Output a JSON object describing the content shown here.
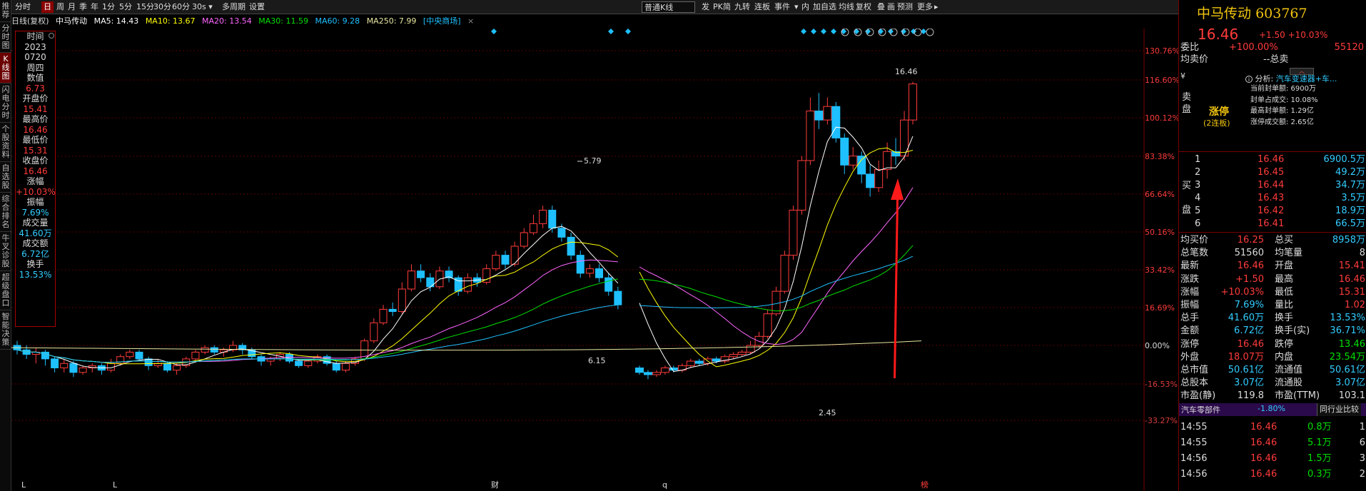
{
  "left_nav": [
    {
      "label": "推荐",
      "active": false
    },
    {
      "label": "分时图",
      "active": false
    },
    {
      "label": "K线图",
      "active": true
    },
    {
      "label": "闪电分时",
      "active": false
    },
    {
      "label": "个股资料",
      "active": false
    },
    {
      "label": "自选股",
      "active": false
    },
    {
      "label": "综合排名",
      "active": false
    },
    {
      "label": "牛叉诊股",
      "active": false
    },
    {
      "label": "超级盘口",
      "active": false
    },
    {
      "label": "智能决策",
      "active": false
    }
  ],
  "toolbar": {
    "items": [
      {
        "label": "分时",
        "active": false
      },
      {
        "label": "日",
        "active": true
      },
      {
        "label": "周",
        "active": false
      },
      {
        "label": "月",
        "active": false
      },
      {
        "label": "季",
        "active": false
      },
      {
        "label": "年",
        "active": false
      },
      {
        "label": "1分",
        "active": false
      },
      {
        "label": "5分",
        "active": false
      },
      {
        "label": "15分",
        "active": false
      },
      {
        "label": "30分",
        "active": false
      },
      {
        "label": "60分",
        "active": false
      },
      {
        "label": "30s ▾",
        "active": false
      },
      {
        "label": "多周期",
        "active": false
      },
      {
        "label": "设置",
        "active": false
      }
    ],
    "kline_type": "普通K线",
    "right_items": [
      "发",
      "PK",
      "简",
      "九转",
      "连板",
      "事件",
      "▾",
      "内",
      "加自选",
      "均线",
      "复权",
      "叠",
      "画",
      "预测",
      "更多",
      "▸"
    ]
  },
  "ma_bar": {
    "period": "日线(复权)",
    "stock": "中马传动",
    "ma5": "MA5: 14.43",
    "ma10": "MA10: 13.67",
    "ma20": "MA20: 13.54",
    "ma30": "MA30: 11.59",
    "ma60": "MA60: 9.28",
    "ma250": "MA250: 7.99",
    "tag": "[中央商场]",
    "close": "×"
  },
  "info_box": {
    "items": [
      {
        "label": "时间",
        "value": "2023",
        "cls": "wh"
      },
      {
        "label": "",
        "value": "0720",
        "cls": "wh"
      },
      {
        "label": "周四",
        "value": "",
        "cls": ""
      },
      {
        "label": "数值",
        "value": "6.73",
        "cls": ""
      },
      {
        "label": "开盘价",
        "value": "15.41",
        "cls": ""
      },
      {
        "label": "最高价",
        "value": "16.46",
        "cls": ""
      },
      {
        "label": "最低价",
        "value": "15.31",
        "cls": ""
      },
      {
        "label": "收盘价",
        "value": "16.46",
        "cls": ""
      },
      {
        "label": "涨幅",
        "value": "+10.03%",
        "cls": ""
      },
      {
        "label": "振幅",
        "value": "7.69%",
        "cls": "c"
      },
      {
        "label": "成交量",
        "value": "41.60万",
        "cls": "c"
      },
      {
        "label": "成交额",
        "value": "6.72亿",
        "cls": "c"
      },
      {
        "label": "换手",
        "value": "13.53%",
        "cls": "c"
      }
    ]
  },
  "y_axis": [
    "130.76%",
    "116.60%",
    "100.12%",
    "83.38%",
    "66.64%",
    "50.16%",
    "33.42%",
    "16.69%",
    "0.00%",
    "-16.53%",
    "-33.27%"
  ],
  "x_axis": [
    "L",
    "L",
    "财",
    "q",
    "榜"
  ],
  "annotations": {
    "high1": "5.79",
    "low1": "6.15",
    "low2": "2.45",
    "high2": "16.46"
  },
  "colors": {
    "up": "#ff3b3b",
    "down": "#1ec0ff",
    "bg": "#000000",
    "ma5": "#ffffff",
    "ma10": "#ffff00",
    "ma20": "#ff66ff",
    "ma30": "#00e000",
    "ma60": "#1ec0ff",
    "ma250": "#e8e6a0"
  },
  "chart_data": {
    "type": "candlestick",
    "title": "中马传动",
    "series_note": "日线(复权)",
    "ylim_pct": [
      -33.27,
      130.76
    ],
    "candles": [
      [
        0,
        -2,
        2,
        -4
      ],
      [
        -2,
        -4,
        0,
        -6
      ],
      [
        -4,
        -3,
        -1,
        -8
      ],
      [
        -3,
        -6,
        -2,
        -9
      ],
      [
        -6,
        -10,
        -5,
        -12
      ],
      [
        -10,
        -8,
        -6,
        -12
      ],
      [
        -8,
        -12,
        -7,
        -14
      ],
      [
        -12,
        -10,
        -9,
        -13
      ],
      [
        -10,
        -9,
        -8,
        -12
      ],
      [
        -9,
        -11,
        -8,
        -13
      ],
      [
        -11,
        -8,
        -6,
        -12
      ],
      [
        -8,
        -5,
        -4,
        -9
      ],
      [
        -5,
        -3,
        -2,
        -6
      ],
      [
        -3,
        -6,
        -2,
        -7
      ],
      [
        -6,
        -9,
        -5,
        -11
      ],
      [
        -9,
        -8,
        -6,
        -10
      ],
      [
        -8,
        -11,
        -7,
        -12
      ],
      [
        -11,
        -9,
        -8,
        -13
      ],
      [
        -9,
        -6,
        -5,
        -10
      ],
      [
        -6,
        -3,
        -2,
        -7
      ],
      [
        -3,
        -1,
        0,
        -4
      ],
      [
        -1,
        -3,
        0,
        -4
      ],
      [
        -3,
        -2,
        -1,
        -5
      ],
      [
        -2,
        0,
        2,
        -3
      ],
      [
        0,
        -2,
        1,
        -4
      ],
      [
        -2,
        -5,
        -1,
        -6
      ],
      [
        -5,
        -7,
        -4,
        -9
      ],
      [
        -7,
        -6,
        -5,
        -9
      ],
      [
        -6,
        -4,
        -3,
        -7
      ],
      [
        -4,
        -7,
        -3,
        -8
      ],
      [
        -7,
        -9,
        -6,
        -10
      ],
      [
        -9,
        -7,
        -6,
        -10
      ],
      [
        -7,
        -5,
        -4,
        -8
      ],
      [
        -5,
        -8,
        -4,
        -9
      ],
      [
        -8,
        -11,
        -7,
        -12
      ],
      [
        -11,
        -8,
        -7,
        -12
      ],
      [
        -8,
        -6,
        -5,
        -9
      ],
      [
        -6,
        2,
        3,
        -7
      ],
      [
        2,
        10,
        12,
        1
      ],
      [
        10,
        16,
        18,
        9
      ],
      [
        16,
        15,
        19,
        13
      ],
      [
        15,
        25,
        28,
        14
      ],
      [
        25,
        33,
        36,
        24
      ],
      [
        33,
        30,
        36,
        28
      ],
      [
        30,
        26,
        32,
        24
      ],
      [
        26,
        33,
        35,
        25
      ],
      [
        33,
        30,
        35,
        28
      ],
      [
        30,
        24,
        31,
        22
      ],
      [
        24,
        30,
        32,
        23
      ],
      [
        30,
        28,
        32,
        26
      ],
      [
        28,
        34,
        36,
        27
      ],
      [
        34,
        40,
        42,
        33
      ],
      [
        40,
        36,
        42,
        34
      ],
      [
        36,
        44,
        46,
        35
      ],
      [
        44,
        50,
        52,
        43
      ],
      [
        50,
        54,
        58,
        49
      ],
      [
        54,
        60,
        62,
        52
      ],
      [
        60,
        52,
        62,
        50
      ],
      [
        52,
        48,
        54,
        46
      ],
      [
        48,
        40,
        50,
        38
      ],
      [
        40,
        32,
        42,
        30
      ],
      [
        32,
        34,
        36,
        30
      ],
      [
        34,
        30,
        36,
        28
      ],
      [
        30,
        24,
        32,
        22
      ],
      [
        24,
        18,
        26,
        16
      ],
      [
        -10,
        -12,
        -9,
        -13
      ],
      [
        -12,
        -13,
        -11,
        -15
      ],
      [
        -13,
        -12,
        -11,
        -14
      ],
      [
        -12,
        -10,
        -9,
        -13
      ],
      [
        -10,
        -11,
        -9,
        -12
      ],
      [
        -11,
        -9,
        -8,
        -12
      ],
      [
        -9,
        -7,
        -6,
        -10
      ],
      [
        -7,
        -8,
        -6,
        -9
      ],
      [
        -8,
        -6,
        -5,
        -9
      ],
      [
        -6,
        -7,
        -5,
        -8
      ],
      [
        -7,
        -5,
        -4,
        -8
      ],
      [
        -5,
        -4,
        -3,
        -6
      ],
      [
        -4,
        -3,
        -2,
        -5
      ],
      [
        -3,
        0,
        2,
        -4
      ],
      [
        0,
        4,
        6,
        -1
      ],
      [
        4,
        14,
        16,
        3
      ],
      [
        14,
        24,
        26,
        13
      ],
      [
        24,
        40,
        42,
        23
      ],
      [
        40,
        60,
        62,
        38
      ],
      [
        60,
        82,
        84,
        58
      ],
      [
        82,
        104,
        110,
        80
      ],
      [
        104,
        100,
        112,
        96
      ],
      [
        100,
        106,
        110,
        98
      ],
      [
        106,
        92,
        108,
        90
      ],
      [
        92,
        80,
        94,
        76
      ],
      [
        80,
        84,
        88,
        78
      ],
      [
        84,
        76,
        86,
        72
      ],
      [
        76,
        70,
        80,
        66
      ],
      [
        70,
        78,
        82,
        68
      ],
      [
        78,
        86,
        90,
        74
      ],
      [
        86,
        84,
        92,
        80
      ],
      [
        84,
        100,
        104,
        82
      ],
      [
        100,
        116,
        117,
        98
      ]
    ]
  },
  "right_panel": {
    "name": "中马传动",
    "code": "603767",
    "price": "16.46",
    "change": "+1.50",
    "pct": "+10.03%",
    "weibi_label": "委比",
    "weibi": "+100.00%",
    "weicha": "55120",
    "junmaijia_label": "均卖价",
    "zongmai_label": "--总卖",
    "sell_label": "卖盘",
    "buy_label": "买盘",
    "zt_title": "涨停",
    "zt_sub": "(2连板)",
    "zt_analysis": "分析:",
    "zt_sector": "汽车变速器+车...",
    "zt_lines": [
      "当前封单额: 6900万",
      "封单占成交: 10.08%",
      "最高封单额: 1.29亿",
      "涨停成交额: 2.65亿"
    ],
    "bids": [
      {
        "n": "1",
        "p": "16.46",
        "v": "6900.5万"
      },
      {
        "n": "2",
        "p": "16.45",
        "v": "49.2万"
      },
      {
        "n": "3",
        "p": "16.44",
        "v": "34.7万"
      },
      {
        "n": "4",
        "p": "16.43",
        "v": "3.5万"
      },
      {
        "n": "5",
        "p": "16.42",
        "v": "18.9万"
      },
      {
        "n": "6",
        "p": "16.41",
        "v": "66.5万"
      }
    ],
    "stats": [
      {
        "l1": "均买价",
        "v1": "16.25",
        "l2": "总买",
        "v2": "8958万",
        "c1": "red",
        "c2": "cy"
      },
      {
        "l1": "总笔数",
        "v1": "51560",
        "l2": "均笔量",
        "v2": "8",
        "c1": "wh",
        "c2": "wh"
      },
      {
        "l1": "最新",
        "v1": "16.46",
        "l2": "开盘",
        "v2": "15.41",
        "c1": "red",
        "c2": "red"
      },
      {
        "l1": "涨跌",
        "v1": "+1.50",
        "l2": "最高",
        "v2": "16.46",
        "c1": "red",
        "c2": "red"
      },
      {
        "l1": "涨幅",
        "v1": "+10.03%",
        "l2": "最低",
        "v2": "15.31",
        "c1": "red",
        "c2": "red"
      },
      {
        "l1": "振幅",
        "v1": "7.69%",
        "l2": "量比",
        "v2": "1.02",
        "c1": "cy",
        "c2": "red"
      },
      {
        "l1": "总手",
        "v1": "41.60万",
        "l2": "换手",
        "v2": "13.53%",
        "c1": "cy",
        "c2": "cy"
      },
      {
        "l1": "金额",
        "v1": "6.72亿",
        "l2": "换手(实)",
        "v2": "36.71%",
        "c1": "cy",
        "c2": "cy"
      },
      {
        "l1": "涨停",
        "v1": "16.46",
        "l2": "跌停",
        "v2": "13.46",
        "c1": "red",
        "c2": "grn"
      },
      {
        "l1": "外盘",
        "v1": "18.07万",
        "l2": "内盘",
        "v2": "23.54万",
        "c1": "red",
        "c2": "grn"
      },
      {
        "l1": "总市值",
        "v1": "50.61亿",
        "l2": "流通值",
        "v2": "50.61亿",
        "c1": "cy",
        "c2": "cy"
      },
      {
        "l1": "总股本",
        "v1": "3.07亿",
        "l2": "流通股",
        "v2": "3.07亿",
        "c1": "cy",
        "c2": "cy"
      },
      {
        "l1": "市盈(静)",
        "v1": "119.8",
        "l2": "市盈(TTM)",
        "v2": "103.1",
        "c1": "wh",
        "c2": "wh"
      }
    ],
    "sector": "汽车零部件",
    "sector_pct": "-1.80%",
    "compare": "同行业比较",
    "ticks": [
      {
        "t": "14:55",
        "p": "16.46",
        "v": "0.8万",
        "x": "1"
      },
      {
        "t": "14:55",
        "p": "16.46",
        "v": "5.1万",
        "x": "6"
      },
      {
        "t": "14:56",
        "p": "16.46",
        "v": "1.5万",
        "x": "3"
      },
      {
        "t": "14:56",
        "p": "16.46",
        "v": "0.3万",
        "x": "2"
      }
    ]
  }
}
